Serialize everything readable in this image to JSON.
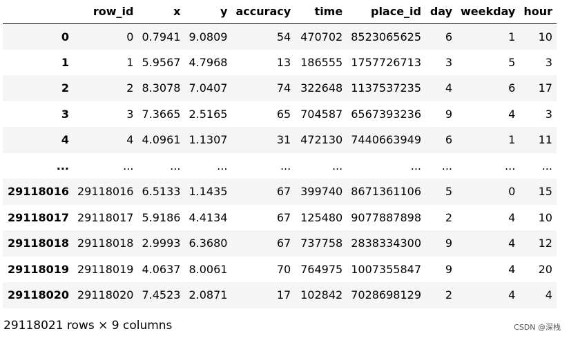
{
  "table": {
    "columns": [
      "",
      "row_id",
      "x",
      "y",
      "accuracy",
      "time",
      "place_id",
      "day",
      "weekday",
      "hour"
    ],
    "rows": [
      [
        "0",
        "0",
        "0.7941",
        "9.0809",
        "54",
        "470702",
        "8523065625",
        "6",
        "1",
        "10"
      ],
      [
        "1",
        "1",
        "5.9567",
        "4.7968",
        "13",
        "186555",
        "1757726713",
        "3",
        "5",
        "3"
      ],
      [
        "2",
        "2",
        "8.3078",
        "7.0407",
        "74",
        "322648",
        "1137537235",
        "4",
        "6",
        "17"
      ],
      [
        "3",
        "3",
        "7.3665",
        "2.5165",
        "65",
        "704587",
        "6567393236",
        "9",
        "4",
        "3"
      ],
      [
        "4",
        "4",
        "4.0961",
        "1.1307",
        "31",
        "472130",
        "7440663949",
        "6",
        "1",
        "11"
      ],
      [
        "...",
        "...",
        "...",
        "...",
        "...",
        "...",
        "...",
        "...",
        "...",
        "..."
      ],
      [
        "29118016",
        "29118016",
        "6.5133",
        "1.1435",
        "67",
        "399740",
        "8671361106",
        "5",
        "0",
        "15"
      ],
      [
        "29118017",
        "29118017",
        "5.9186",
        "4.4134",
        "67",
        "125480",
        "9077887898",
        "2",
        "4",
        "10"
      ],
      [
        "29118018",
        "29118018",
        "2.9993",
        "6.3680",
        "67",
        "737758",
        "2838334300",
        "9",
        "4",
        "12"
      ],
      [
        "29118019",
        "29118019",
        "4.0637",
        "8.0061",
        "70",
        "764975",
        "1007355847",
        "9",
        "4",
        "20"
      ],
      [
        "29118020",
        "29118020",
        "7.4523",
        "2.0871",
        "17",
        "102842",
        "7028698129",
        "2",
        "4",
        "4"
      ]
    ]
  },
  "footer": {
    "shape_text": "29118021 rows × 9 columns"
  },
  "watermark": {
    "text": "CSDN @深栈"
  }
}
